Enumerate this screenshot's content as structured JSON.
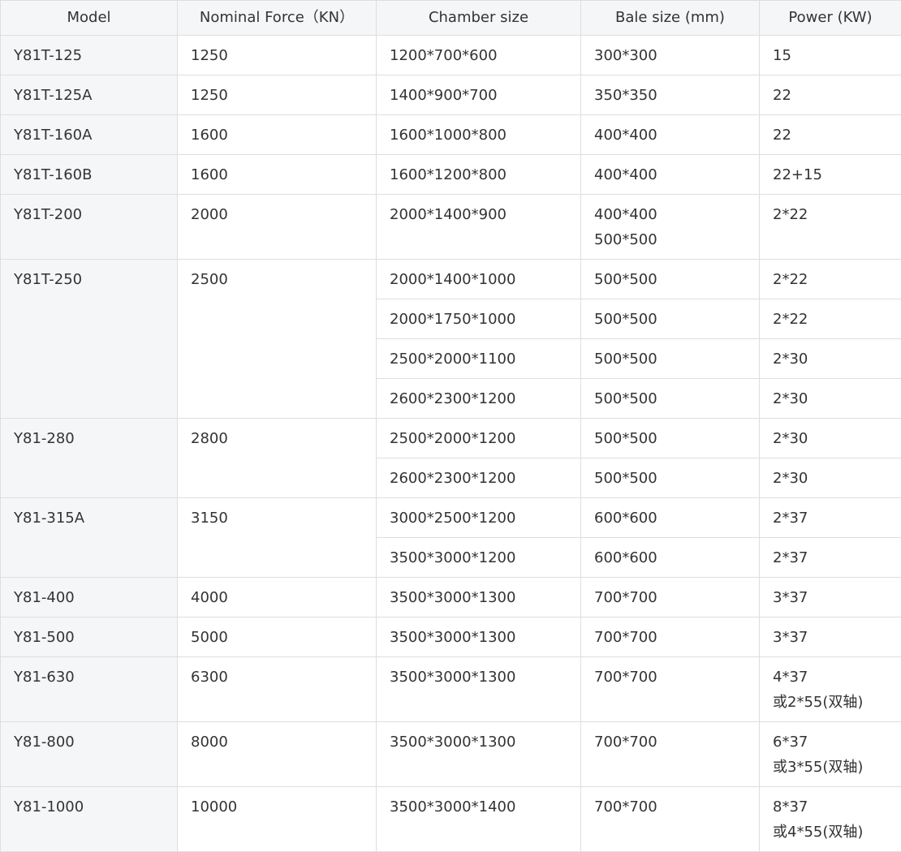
{
  "headers": [
    "Model",
    "Nominal Force（KN）",
    "Chamber size",
    "Bale size (mm)",
    "Power (KW)"
  ],
  "rows": [
    {
      "model": "Y81T-125",
      "force": "1250",
      "variants": [
        {
          "chamber": "1200*700*600",
          "bale": [
            "300*300"
          ],
          "power": [
            "15"
          ]
        }
      ]
    },
    {
      "model": "Y81T-125A",
      "force": "1250",
      "variants": [
        {
          "chamber": "1400*900*700",
          "bale": [
            "350*350"
          ],
          "power": [
            "22"
          ]
        }
      ]
    },
    {
      "model": "Y81T-160A",
      "force": "1600",
      "variants": [
        {
          "chamber": "1600*1000*800",
          "bale": [
            "400*400"
          ],
          "power": [
            "22"
          ]
        }
      ]
    },
    {
      "model": "Y81T-160B",
      "force": "1600",
      "variants": [
        {
          "chamber": "1600*1200*800",
          "bale": [
            "400*400"
          ],
          "power": [
            "22+15"
          ]
        }
      ]
    },
    {
      "model": "Y81T-200",
      "force": "2000",
      "variants": [
        {
          "chamber": "2000*1400*900",
          "bale": [
            "400*400",
            "500*500"
          ],
          "power": [
            "2*22"
          ]
        }
      ]
    },
    {
      "model": "Y81T-250",
      "force": "2500",
      "variants": [
        {
          "chamber": "2000*1400*1000",
          "bale": [
            "500*500"
          ],
          "power": [
            "2*22"
          ]
        },
        {
          "chamber": "2000*1750*1000",
          "bale": [
            "500*500"
          ],
          "power": [
            "2*22"
          ]
        },
        {
          "chamber": "2500*2000*1100",
          "bale": [
            "500*500"
          ],
          "power": [
            "2*30"
          ]
        },
        {
          "chamber": "2600*2300*1200",
          "bale": [
            "500*500"
          ],
          "power": [
            "2*30"
          ]
        }
      ]
    },
    {
      "model": "Y81-280",
      "force": "2800",
      "variants": [
        {
          "chamber": "2500*2000*1200",
          "bale": [
            "500*500"
          ],
          "power": [
            "2*30"
          ]
        },
        {
          "chamber": "2600*2300*1200",
          "bale": [
            "500*500"
          ],
          "power": [
            "2*30"
          ]
        }
      ]
    },
    {
      "model": "Y81-315A",
      "force": "3150",
      "variants": [
        {
          "chamber": "3000*2500*1200",
          "bale": [
            "600*600"
          ],
          "power": [
            "2*37"
          ]
        },
        {
          "chamber": "3500*3000*1200",
          "bale": [
            "600*600"
          ],
          "power": [
            "2*37"
          ]
        }
      ]
    },
    {
      "model": "Y81-400",
      "force": "4000",
      "variants": [
        {
          "chamber": "3500*3000*1300",
          "bale": [
            "700*700"
          ],
          "power": [
            "3*37"
          ]
        }
      ]
    },
    {
      "model": "Y81-500",
      "force": "5000",
      "variants": [
        {
          "chamber": "3500*3000*1300",
          "bale": [
            "700*700"
          ],
          "power": [
            "3*37"
          ]
        }
      ]
    },
    {
      "model": "Y81-630",
      "force": "6300",
      "variants": [
        {
          "chamber": "3500*3000*1300",
          "bale": [
            "700*700"
          ],
          "power": [
            "4*37",
            "或2*55(双轴)"
          ]
        }
      ]
    },
    {
      "model": "Y81-800",
      "force": "8000",
      "variants": [
        {
          "chamber": "3500*3000*1300",
          "bale": [
            "700*700"
          ],
          "power": [
            "6*37",
            "或3*55(双轴)"
          ]
        }
      ]
    },
    {
      "model": "Y81-1000",
      "force": "10000",
      "variants": [
        {
          "chamber": "3500*3000*1400",
          "bale": [
            "700*700"
          ],
          "power": [
            "8*37",
            "或4*55(双轴)"
          ]
        }
      ]
    }
  ]
}
